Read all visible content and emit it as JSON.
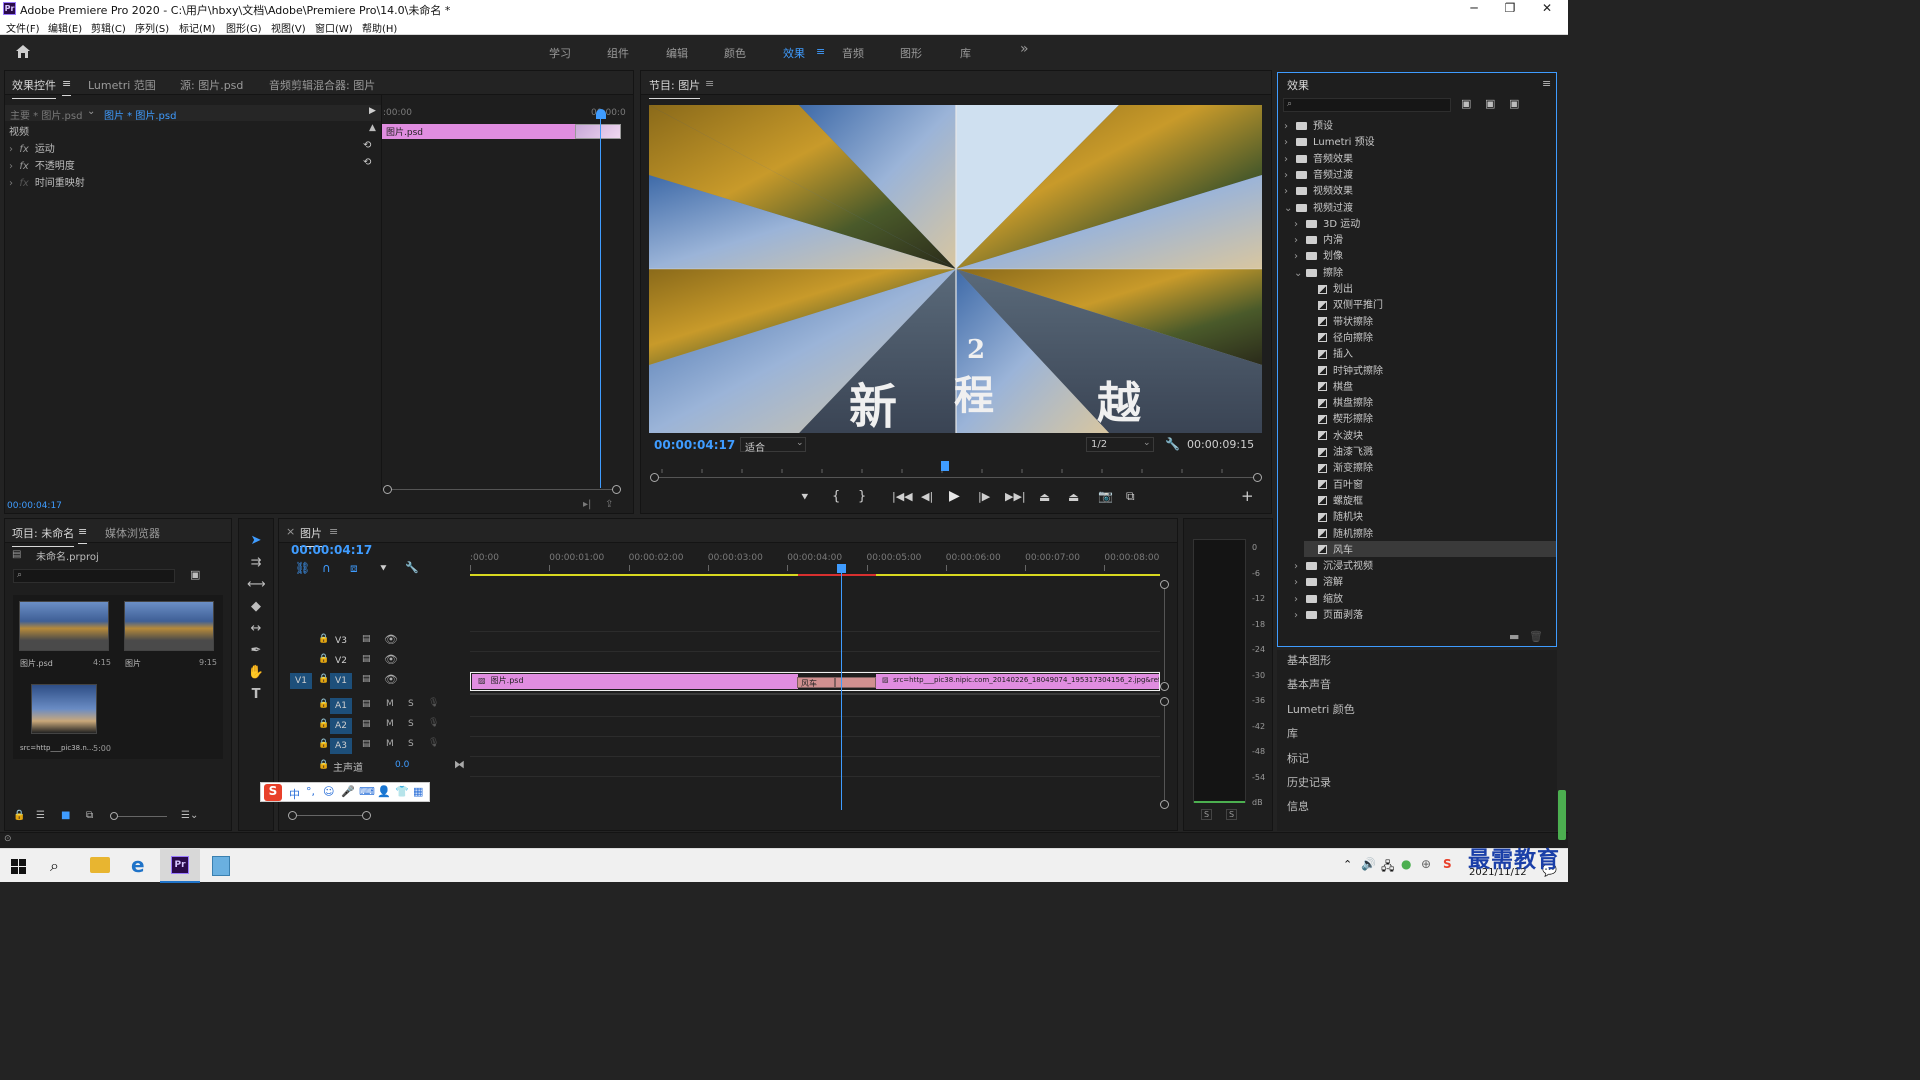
{
  "window": {
    "app_badge": "Pr",
    "title": "Adobe Premiere Pro 2020 - C:\\用户\\hbxy\\文档\\Adobe\\Premiere Pro\\14.0\\未命名 *",
    "minimize": "─",
    "restore": "❐",
    "close": "✕"
  },
  "menu": [
    "文件(F)",
    "编辑(E)",
    "剪辑(C)",
    "序列(S)",
    "标记(M)",
    "图形(G)",
    "视图(V)",
    "窗口(W)",
    "帮助(H)"
  ],
  "workspace": {
    "tabs": [
      "学习",
      "组件",
      "编辑",
      "颜色",
      "效果",
      "音频",
      "图形",
      "库"
    ],
    "active": "效果",
    "overflow": "»"
  },
  "effect_controls": {
    "tabs": [
      "效果控件",
      "Lumetri 范围",
      "源: 图片.psd",
      "音频剪辑混合器: 图片"
    ],
    "tab_menu": "≡",
    "master_label": "主要 * 图片.psd",
    "clip_label": "图片 * 图片.psd",
    "section": "视频",
    "rows": [
      "运动",
      "不透明度",
      "时间重映射"
    ],
    "fx": "fx",
    "ruler_start": ":00:00",
    "ruler_end": "00:00:0",
    "clip_name": "图片.psd",
    "timecode": "00:00:04:17"
  },
  "program_monitor": {
    "title": "节目: 图片",
    "timecode": "00:00:04:17",
    "fit": "适合",
    "resolution": "1/2",
    "duration": "00:00:09:15",
    "overlay_chars": [
      "新",
      "2",
      "程",
      "越"
    ]
  },
  "effects_panel": {
    "title": "效果",
    "menu": "≡",
    "items": [
      {
        "label": "预设",
        "kind": "folder",
        "indent": 0,
        "arrow": "›"
      },
      {
        "label": "Lumetri 预设",
        "kind": "folder",
        "indent": 0,
        "arrow": "›"
      },
      {
        "label": "音频效果",
        "kind": "folder",
        "indent": 0,
        "arrow": "›"
      },
      {
        "label": "音频过渡",
        "kind": "folder",
        "indent": 0,
        "arrow": "›"
      },
      {
        "label": "视频效果",
        "kind": "folder",
        "indent": 0,
        "arrow": "›"
      },
      {
        "label": "视频过渡",
        "kind": "folder",
        "indent": 0,
        "arrow": "⌄"
      },
      {
        "label": "3D 运动",
        "kind": "folder",
        "indent": 1,
        "arrow": "›"
      },
      {
        "label": "内滑",
        "kind": "folder",
        "indent": 1,
        "arrow": "›"
      },
      {
        "label": "划像",
        "kind": "folder",
        "indent": 1,
        "arrow": "›"
      },
      {
        "label": "擦除",
        "kind": "folder",
        "indent": 1,
        "arrow": "⌄"
      },
      {
        "label": "划出",
        "kind": "effect",
        "indent": 2
      },
      {
        "label": "双侧平推门",
        "kind": "effect",
        "indent": 2
      },
      {
        "label": "带状擦除",
        "kind": "effect",
        "indent": 2
      },
      {
        "label": "径向擦除",
        "kind": "effect",
        "indent": 2
      },
      {
        "label": "插入",
        "kind": "effect",
        "indent": 2
      },
      {
        "label": "时钟式擦除",
        "kind": "effect",
        "indent": 2
      },
      {
        "label": "棋盘",
        "kind": "effect",
        "indent": 2
      },
      {
        "label": "棋盘擦除",
        "kind": "effect",
        "indent": 2
      },
      {
        "label": "楔形擦除",
        "kind": "effect",
        "indent": 2
      },
      {
        "label": "水波块",
        "kind": "effect",
        "indent": 2
      },
      {
        "label": "油漆飞溅",
        "kind": "effect",
        "indent": 2
      },
      {
        "label": "渐变擦除",
        "kind": "effect",
        "indent": 2
      },
      {
        "label": "百叶窗",
        "kind": "effect",
        "indent": 2
      },
      {
        "label": "螺旋框",
        "kind": "effect",
        "indent": 2
      },
      {
        "label": "随机块",
        "kind": "effect",
        "indent": 2
      },
      {
        "label": "随机擦除",
        "kind": "effect",
        "indent": 2
      },
      {
        "label": "风车",
        "kind": "effect",
        "indent": 2,
        "selected": true
      },
      {
        "label": "沉浸式视频",
        "kind": "folder",
        "indent": 1,
        "arrow": "›"
      },
      {
        "label": "溶解",
        "kind": "folder",
        "indent": 1,
        "arrow": "›"
      },
      {
        "label": "缩放",
        "kind": "folder",
        "indent": 1,
        "arrow": "›"
      },
      {
        "label": "页面剥落",
        "kind": "folder",
        "indent": 1,
        "arrow": "›"
      }
    ]
  },
  "side_panels": [
    "基本图形",
    "基本声音",
    "Lumetri 颜色",
    "库",
    "标记",
    "历史记录",
    "信息"
  ],
  "project": {
    "tabs": [
      "项目: 未命名",
      "媒体浏览器"
    ],
    "menu": "≡",
    "file": "未命名.prproj",
    "items": [
      {
        "name": "图片.psd",
        "duration": "4:15"
      },
      {
        "name": "图片",
        "duration": "9:15"
      },
      {
        "name": "src=http___pic38.n...",
        "duration": "5:00"
      }
    ]
  },
  "timeline": {
    "tab": "图片",
    "close": "×",
    "menu": "≡",
    "timecode": "00:00:04:17",
    "ruler": [
      ":00:00",
      "00:00:01:00",
      "00:00:02:00",
      "00:00:03:00",
      "00:00:04:00",
      "00:00:05:00",
      "00:00:06:00",
      "00:00:07:00",
      "00:00:08:00"
    ],
    "video_tracks": [
      "V3",
      "V2",
      "V1"
    ],
    "audio_tracks": [
      "A1",
      "A2",
      "A3"
    ],
    "source_patch": "V1",
    "mute": "M",
    "solo": "S",
    "master": "主声道",
    "master_value": "0.0",
    "clip1": "图片.psd",
    "transition": "风车",
    "clip2": "src=http___pic38.nipic.com_20140226_18049074_195317304156_2.jpg&refer"
  },
  "meter": {
    "scale": [
      "0",
      "-6",
      "-12",
      "-18",
      "-24",
      "-30",
      "-36",
      "-42",
      "-48",
      "-54",
      "dB"
    ],
    "solo_left": "S",
    "solo_right": "S"
  },
  "ime": {
    "logo": "S",
    "lang": "中"
  },
  "watermark": "最需教育",
  "clock": {
    "date": "2021/11/12"
  }
}
